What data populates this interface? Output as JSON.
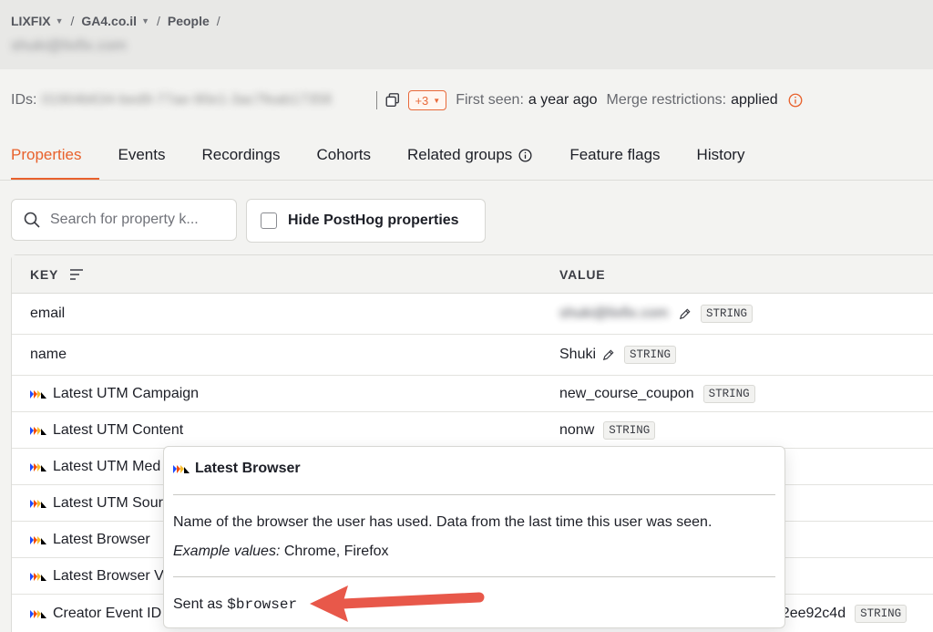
{
  "breadcrumb": {
    "items": [
      {
        "label": "LIXFIX",
        "dropdown": true
      },
      {
        "label": "GA4.co.il",
        "dropdown": true
      },
      {
        "label": "People",
        "dropdown": false
      }
    ],
    "separator": "/"
  },
  "person": {
    "title": "shuki@lixfix.com"
  },
  "ids_row": {
    "ids_label": "IDs:",
    "ids_value": "01904b634-bed9-77ae-90e1-3ac7feab17358",
    "extra_badge": "+3",
    "first_seen_label": "First seen:",
    "first_seen_value": "a year ago",
    "merge_label": "Merge restrictions:",
    "merge_value": "applied"
  },
  "tabs": [
    {
      "label": "Properties",
      "active": true
    },
    {
      "label": "Events"
    },
    {
      "label": "Recordings"
    },
    {
      "label": "Cohorts"
    },
    {
      "label": "Related groups",
      "info": true
    },
    {
      "label": "Feature flags"
    },
    {
      "label": "History"
    }
  ],
  "search": {
    "placeholder": "Search for property k..."
  },
  "hide_posthog": {
    "label": "Hide PostHog properties",
    "checked": false
  },
  "table": {
    "columns": [
      "KEY",
      "VALUE"
    ],
    "rows": [
      {
        "key": "email",
        "posthog": false,
        "value": "shuki@lixfix.com",
        "blurred": true,
        "editable": true,
        "type": "STRING"
      },
      {
        "key": "name",
        "posthog": false,
        "value": "Shuki",
        "editable": true,
        "type": "STRING"
      },
      {
        "key": "Latest UTM Campaign",
        "posthog": true,
        "value": "new_course_coupon",
        "type": "STRING"
      },
      {
        "key": "Latest UTM Content",
        "posthog": true,
        "value": "nonw",
        "type": "STRING"
      },
      {
        "key": "Latest UTM Med",
        "posthog": true,
        "value": "",
        "type": ""
      },
      {
        "key": "Latest UTM Sour",
        "posthog": true,
        "value": "",
        "type": ""
      },
      {
        "key": "Latest Browser",
        "posthog": true,
        "value": "",
        "type": ""
      },
      {
        "key": "Latest Browser V",
        "posthog": true,
        "value": "",
        "type": ""
      },
      {
        "key": "Creator Event ID",
        "posthog": true,
        "value": "522ee92c4d",
        "type": "STRING"
      }
    ]
  },
  "tooltip": {
    "title": "Latest Browser",
    "description": "Name of the browser the user has used. Data from the last time this user was seen.",
    "example_label": "Example values:",
    "example_values": "Chrome, Firefox",
    "sent_as_label": "Sent as",
    "sent_as_value": "$browser"
  },
  "colors": {
    "accent": "#e8612c",
    "arrow": "#e8584a"
  },
  "icons": [
    "chevron-down-icon",
    "copy-icon",
    "info-icon",
    "search-icon",
    "sort-icon",
    "posthog-logo-icon",
    "pencil-icon"
  ]
}
